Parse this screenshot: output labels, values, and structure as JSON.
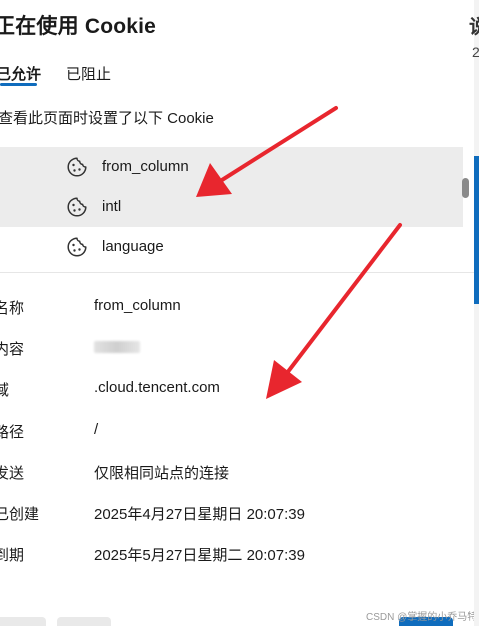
{
  "dialog": {
    "title": "正在使用 Cookie",
    "tabs": [
      {
        "label": "已允许",
        "active": true
      },
      {
        "label": "已阻止",
        "active": false
      }
    ],
    "subtitle": "查看此页面时设置了以下 Cookie"
  },
  "cookie_list": [
    {
      "name": "from_column",
      "icon": "cookie-icon",
      "selected": true
    },
    {
      "name": "intl",
      "icon": "cookie-icon",
      "selected": true
    },
    {
      "name": "language",
      "icon": "cookie-icon",
      "selected": false
    }
  ],
  "details": [
    {
      "label": "名称",
      "value": "from_column"
    },
    {
      "label": "内容",
      "value": "20018"
    },
    {
      "label": "域",
      "value": ".cloud.tencent.com"
    },
    {
      "label": "路径",
      "value": "/"
    },
    {
      "label": "发送",
      "value": "仅限相同站点的连接"
    },
    {
      "label": "已创建",
      "value": "2025年4月27日星期日 20:07:39"
    },
    {
      "label": "到期",
      "value": "2025年5月27日星期二 20:07:39"
    }
  ],
  "watermark": "CSDN @掌握的小乔马特",
  "colors": {
    "accent": "#0f6cbd",
    "annotation_arrow": "#e8262e",
    "selected_row": "#ececec"
  }
}
